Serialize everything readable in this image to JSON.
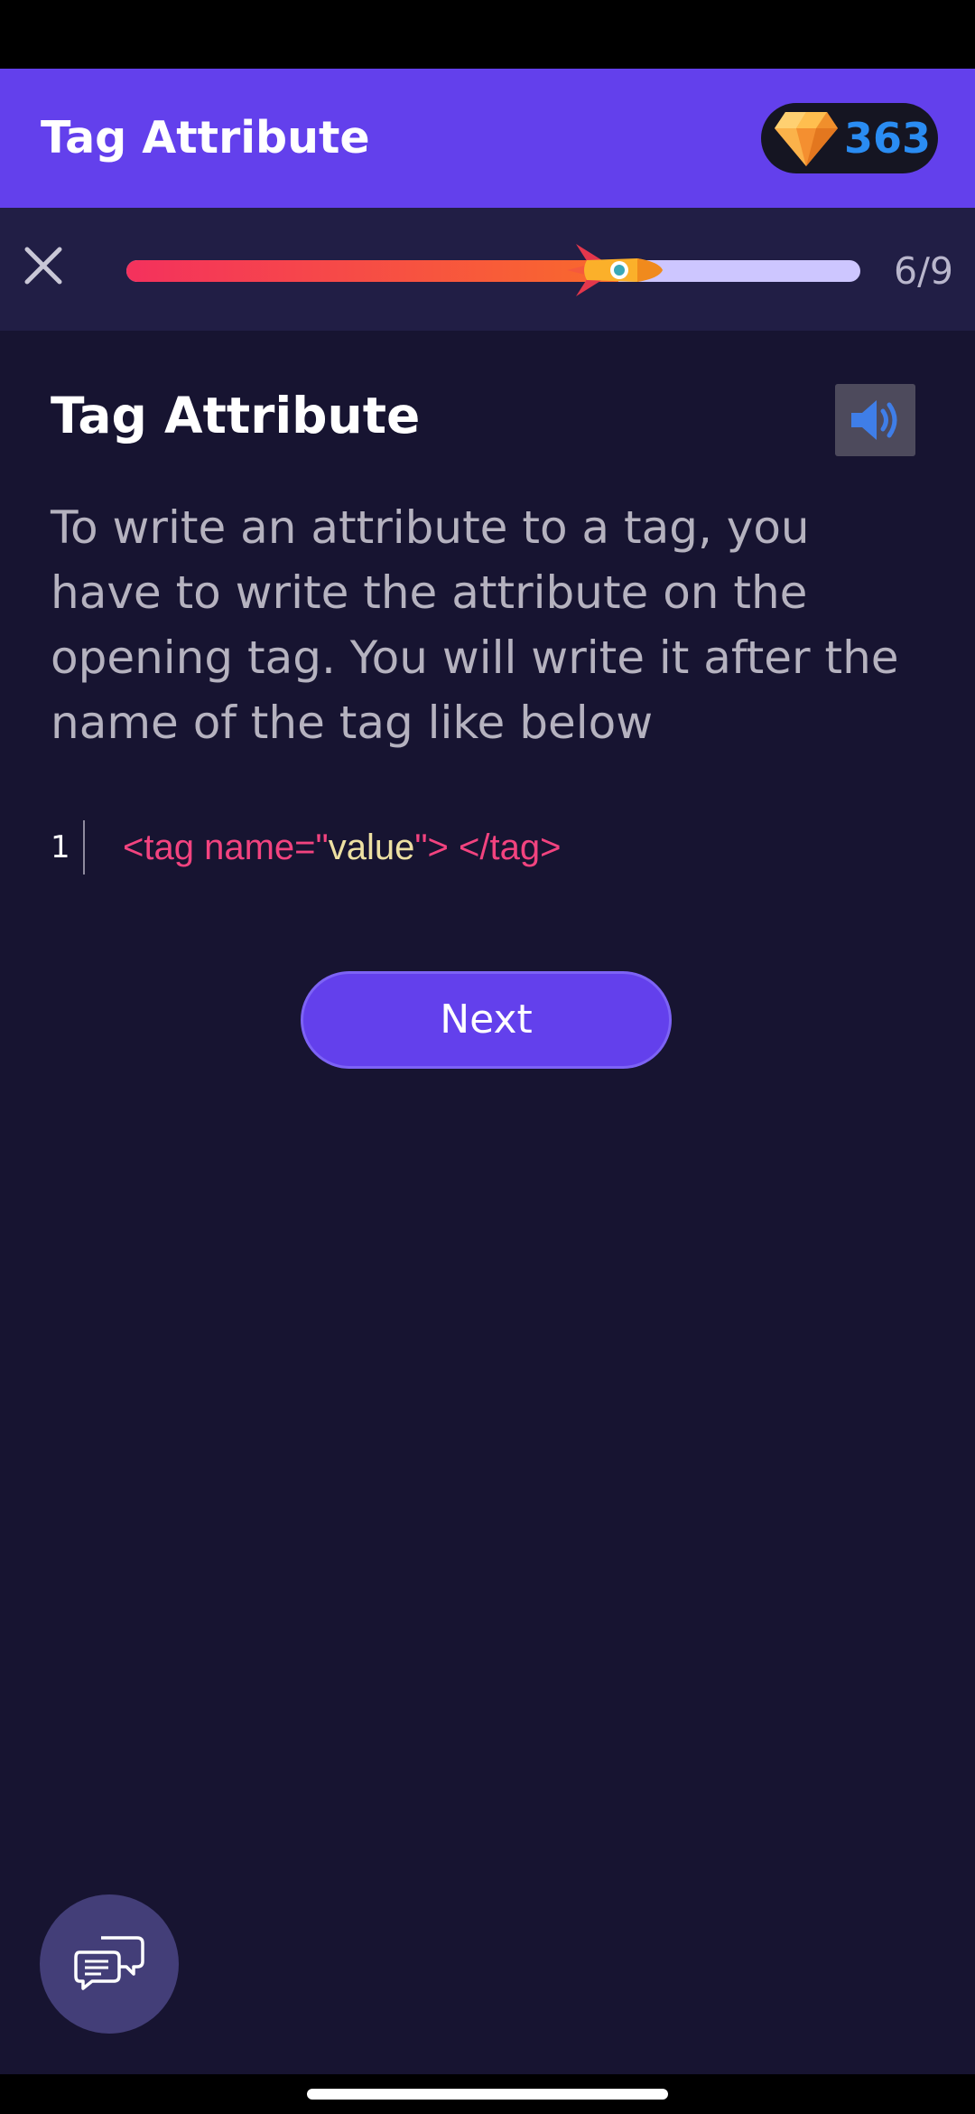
{
  "header": {
    "title": "Tag Attribute",
    "gem_count": "363"
  },
  "progress": {
    "current_step": 6,
    "total_steps": 9,
    "label": "6/9",
    "fraction_complete": 0.67
  },
  "lesson": {
    "title": "Tag Attribute",
    "body": "To write an attribute to a tag, you have to write the attribute on the opening tag. You will write it after the name of the tag like below",
    "code": {
      "line_number": "1",
      "tokens": {
        "open_start": "<tag name=\"",
        "value": "value",
        "open_end": "\"> </tag>"
      }
    }
  },
  "actions": {
    "next_label": "Next"
  },
  "icons": {
    "close": "close-icon",
    "gem": "gem-icon",
    "rocket": "rocket-icon",
    "sound": "speaker-icon",
    "chat": "chat-bubbles-icon"
  },
  "colors": {
    "accent": "#6340ec",
    "background": "#171431",
    "gem_count": "#2a8cf2",
    "code_tag": "#f2437f",
    "code_value": "#ede0a2"
  }
}
